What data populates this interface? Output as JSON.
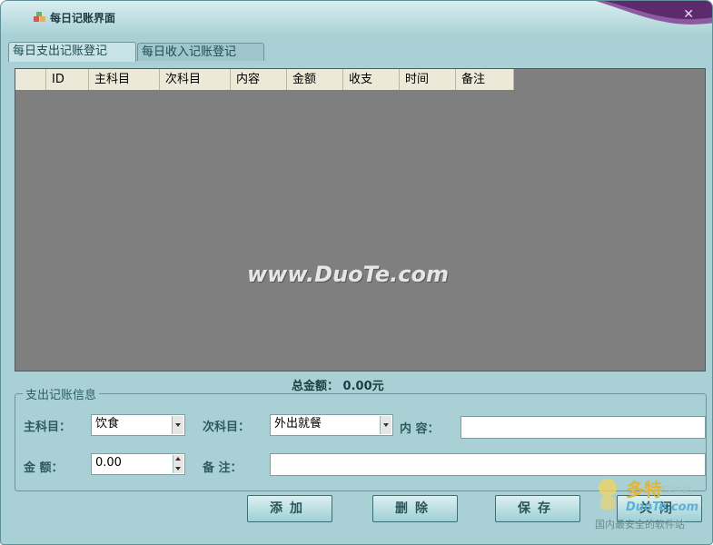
{
  "window": {
    "title": "每日记账界面",
    "close_glyph": "✕"
  },
  "tabs": [
    {
      "label": "每日支出记账登记",
      "active": true
    },
    {
      "label": "每日收入记账登记",
      "active": false
    }
  ],
  "grid": {
    "columns": [
      "",
      "ID",
      "主科目",
      "次科目",
      "内容",
      "金额",
      "收支",
      "时间",
      "备注"
    ],
    "rows": []
  },
  "watermark": "www.DuoTe.com",
  "total": {
    "label": "总金额：",
    "value": "0.00元"
  },
  "form": {
    "legend": "支出记账信息",
    "main_category": {
      "label": "主科目：",
      "value": "饮食"
    },
    "sub_category": {
      "label": "次科目：",
      "value": "外出就餐"
    },
    "content": {
      "label": "内  容：",
      "value": ""
    },
    "amount": {
      "label": "金  额：",
      "value": "0.00"
    },
    "note": {
      "label": "备  注：",
      "value": ""
    }
  },
  "buttons": {
    "add": "添加",
    "delete": "删除",
    "save": "保存",
    "close": "关闭"
  },
  "logo": {
    "zh": "多特",
    "zh_sub": "软件站",
    "en": "DuoTe.com",
    "slogan": "国内最安全的软件站"
  },
  "colors": {
    "window_bg": "#a9d1d5",
    "grid_bg": "#7f7f7f",
    "header_bg": "#ece9d8",
    "accent": "#5e2a6e"
  }
}
